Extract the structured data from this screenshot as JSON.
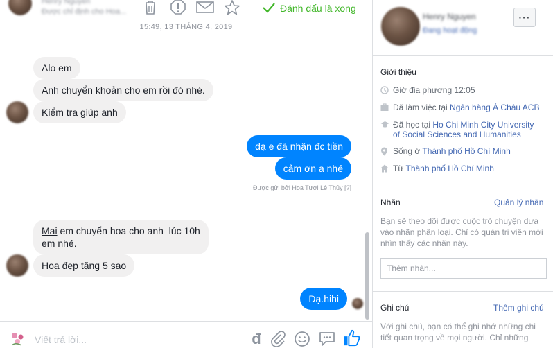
{
  "header": {
    "contact_name": "Henry Nguyen",
    "contact_sub": "Được chỉ định cho Hoa...",
    "mark_done_label": "Đánh dấu là xong",
    "timestamp": "15:49, 13 THÁNG 4, 2019"
  },
  "messages": [
    {
      "dir": "in",
      "text": "Alo em"
    },
    {
      "dir": "in",
      "text": "Anh chuyển khoản cho em rồi đó nhé."
    },
    {
      "dir": "in",
      "text": "Kiểm tra giúp anh"
    },
    {
      "dir": "out",
      "text": "dạ e đã nhận đc tiền"
    },
    {
      "dir": "out",
      "text": "cảm ơn a nhé"
    },
    {
      "dir": "in",
      "text_underlined": "Mai",
      "text_line1": " em chuyển hoa cho anh  lúc 10h",
      "text_line2": "em nhé."
    },
    {
      "dir": "in",
      "text": "Hoa đẹp tặng 5 sao"
    },
    {
      "dir": "out",
      "text": "Dạ.hihi"
    }
  ],
  "sent_by": "Được gửi bởi Hoa Tươi Lê Thủy",
  "sent_by_help": "[?]",
  "composer": {
    "placeholder": "Viết trả lời...",
    "currency_symbol": "đ"
  },
  "profile": {
    "name": "Henry Nguyen",
    "status": "Đang hoạt động",
    "more_label": "···"
  },
  "intro": {
    "title": "Giới thiệu",
    "local_time": "Giờ địa phương 12:05",
    "work_prefix": "Đã làm việc tại ",
    "work_link": "Ngân hàng Á Châu ACB",
    "study_prefix": "Đã học tại ",
    "study_link_line1": "Ho Chi Minh City University",
    "study_link_line2": "of Social Sciences and Humanities",
    "lives_prefix": "Sống ở ",
    "lives_link": "Thành phố Hồ Chí Minh",
    "from_prefix": "Từ ",
    "from_link": "Thành phố Hồ Chí Minh"
  },
  "labels": {
    "title": "Nhãn",
    "manage_link": "Quản lý nhãn",
    "description": "Bạn sẽ theo dõi được cuộc trò chuyện dựa vào nhãn phân loại. Chỉ có quản trị viên mới nhìn thấy các nhãn này.",
    "input_placeholder": "Thêm nhãn..."
  },
  "notes": {
    "title": "Ghi chú",
    "add_link": "Thêm ghi chú",
    "description": "Với ghi chú, bạn có thể ghi nhớ những chi tiết quan trọng về mọi người. Chỉ những"
  },
  "colors": {
    "accent": "#0084ff",
    "link": "#4267b2",
    "done_green": "#42b72a",
    "incoming_bubble": "#f1f0f0"
  },
  "icons": [
    "trash-icon",
    "spam-icon",
    "mail-icon",
    "star-icon",
    "check-icon",
    "clock-icon",
    "briefcase-icon",
    "graduation-cap-icon",
    "location-pin-icon",
    "home-icon",
    "attachment-icon",
    "emoji-icon",
    "chat-bubble-icon",
    "thumbs-up-icon"
  ]
}
